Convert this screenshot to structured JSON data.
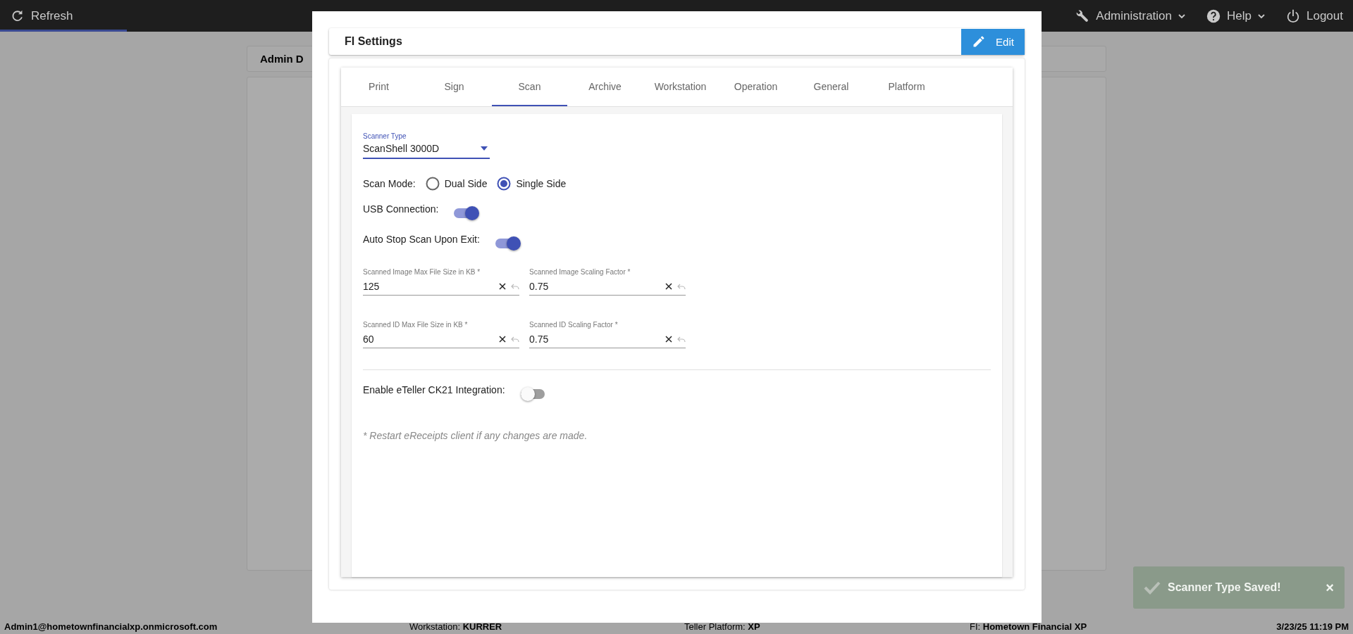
{
  "top_bar": {
    "loading_bar": {
      "level": 0.094
    },
    "items": [
      {
        "label": "Refresh",
        "menu": false
      },
      {
        "label": "Administration",
        "menu": true
      },
      {
        "label": "Help",
        "menu": true
      },
      {
        "label": "Logout",
        "menu": false
      }
    ]
  },
  "background_page": {
    "panel_title": "Admin D"
  },
  "dialog": {
    "title": "FI Settings",
    "edit_button": "Edit",
    "tabs": [
      {
        "label": "Print",
        "selected": false
      },
      {
        "label": "Sign",
        "selected": false
      },
      {
        "label": "Scan",
        "selected": true
      },
      {
        "label": "Archive",
        "selected": false
      },
      {
        "label": "Workstation",
        "selected": false
      },
      {
        "label": "Operation",
        "selected": false
      },
      {
        "label": "General",
        "selected": false
      },
      {
        "label": "Platform",
        "selected": false
      }
    ],
    "scanner_type": {
      "label": "Scanner Type",
      "value": "ScanShell 3000D"
    },
    "scan_mode": {
      "label": "Scan Mode:",
      "options": [
        {
          "label": "Dual Side",
          "selected": false
        },
        {
          "label": "Single Side",
          "selected": true
        }
      ]
    },
    "toggles": [
      {
        "label": "USB Connection:",
        "on": true
      },
      {
        "label": "Auto Stop Scan Upon Exit:",
        "on": true
      }
    ],
    "fields": [
      {
        "label": "Scanned Image Max File Size in KB *",
        "value": "125"
      },
      {
        "label": "Scanned Image Scaling Factor *",
        "value": "0.75"
      },
      {
        "label": "Scanned ID Max File Size in KB *",
        "value": "60"
      },
      {
        "label": "Scanned ID Scaling Factor *",
        "value": "0.75"
      }
    ],
    "integration_toggle": {
      "label": "Enable eTeller CK21 Integration:",
      "on": false
    },
    "note": "* Restart eReceipts client if any changes are made."
  },
  "toast": {
    "message": "Scanner Type Saved!",
    "close": "×"
  },
  "status_bar": [
    {
      "text": "**Admin1@hometownfinancialxp.onmicrosoft.com**"
    },
    {
      "text": "Workstation: **KURRER**"
    },
    {
      "text": "Teller Platform: **XP**"
    },
    {
      "text": "FI: **Hometown Financial XP**"
    },
    {
      "text": "**3/23/25 11:19 PM**"
    }
  ]
}
